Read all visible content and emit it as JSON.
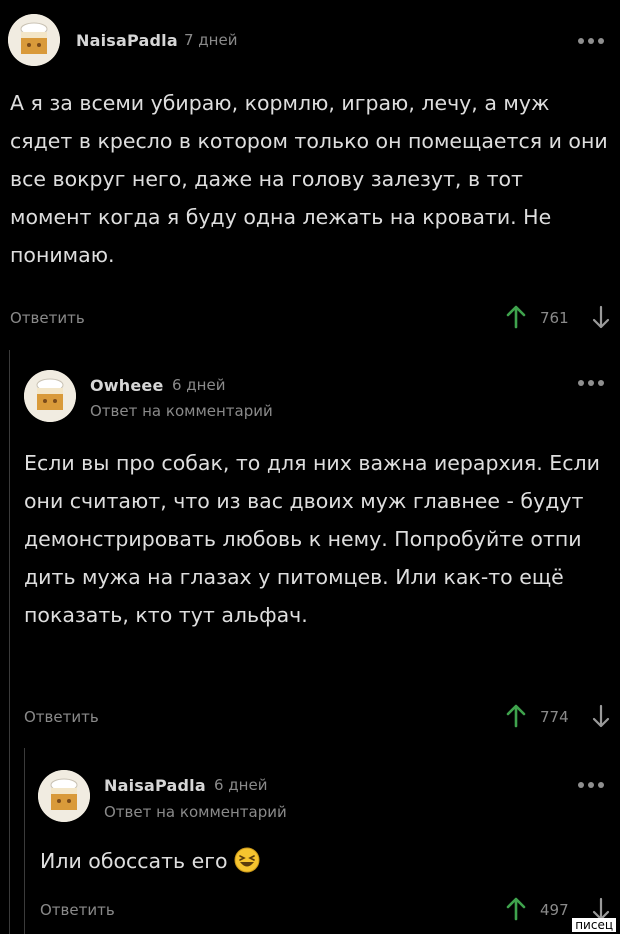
{
  "comments": [
    {
      "username": "NaisaPadla",
      "time": "7 дней",
      "text": "А я за всеми убираю, кормлю, играю, лечу, а муж сядет в кресло в котором только он помещается и они все вокруг него, даже на голову залезут, в тот момент когда я буду одна лежать на кровати. Не понимаю.",
      "reply_label": "Ответить",
      "votes": "761"
    },
    {
      "username": "Owheee",
      "time": "6 дней",
      "reply_to": "Ответ на комментарий",
      "text_before": "Если вы про собак, то для них важна иерархия. Если они считают, что из вас двоих муж главнее - будут демонстрировать любовь к нему. Попробуйте отпи",
      "text_after": "дить мужа на глазах у питомцев. Или как-то ещё показать, кто тут альфач.",
      "reply_label": "Ответить",
      "votes": "774"
    },
    {
      "username": "NaisaPadla",
      "time": "6 дней",
      "reply_to": "Ответ на комментарий",
      "text": "Или обоссать его",
      "emoji": "laughing-emoji",
      "reply_label": "Ответить",
      "votes": "497"
    }
  ],
  "watermark": "писец",
  "colors": {
    "upvote": "#3fa34d",
    "text": "#dedede",
    "muted": "#8a8a8a",
    "background": "#000000"
  }
}
